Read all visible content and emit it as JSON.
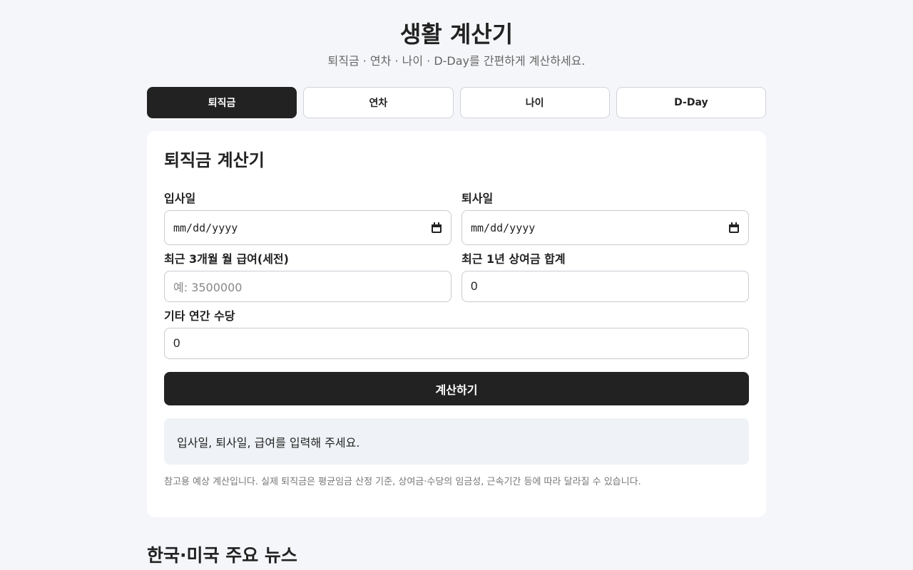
{
  "header": {
    "title": "생활 계산기",
    "subtitle": "퇴직금 · 연차 · 나이 · D-Day를 간편하게 계산하세요."
  },
  "tabs": [
    {
      "label": "퇴직금",
      "active": true
    },
    {
      "label": "연차",
      "active": false
    },
    {
      "label": "나이",
      "active": false
    },
    {
      "label": "D-Day",
      "active": false
    }
  ],
  "calculator": {
    "title": "퇴직금 계산기",
    "start_date": {
      "label": "입사일",
      "placeholder": "mm/dd/yyyy",
      "icon": "calendar-icon"
    },
    "end_date": {
      "label": "퇴사일",
      "placeholder": "mm/dd/yyyy",
      "icon": "calendar-icon"
    },
    "salary": {
      "label": "최근 3개월 월 급여(세전)",
      "placeholder": "예: 3500000",
      "value": ""
    },
    "bonus": {
      "label": "최근 1년 상여금 합계",
      "value": "0"
    },
    "allowance": {
      "label": "기타 연간 수당",
      "value": "0"
    },
    "submit_label": "계산하기",
    "result_text": "입사일, 퇴사일, 급여를 입력해 주세요.",
    "note": "참고용 예상 계산입니다. 실제 퇴직금은 평균임금 산정 기준, 상여금·수당의 임금성, 근속기간 등에 따라 달라질 수 있습니다."
  },
  "news": {
    "title": "한국·미국 주요 뉴스"
  },
  "colors": {
    "background": "#f5f6f9",
    "primary": "#222222",
    "result_bg": "#eff2f6"
  }
}
